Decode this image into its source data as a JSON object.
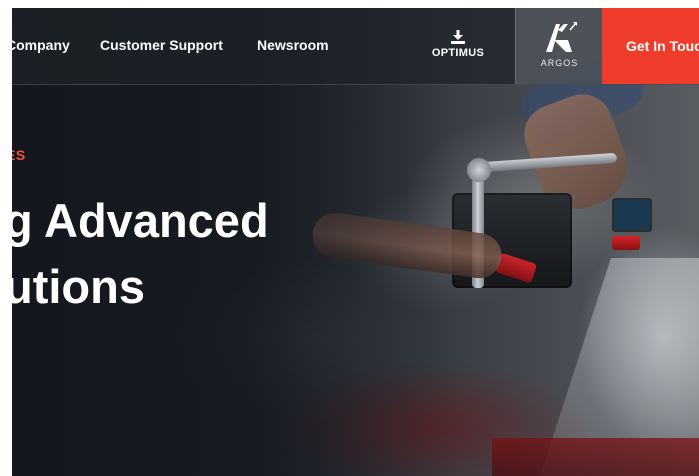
{
  "header": {
    "nav": [
      {
        "label": "Company"
      },
      {
        "label": "Customer Support"
      },
      {
        "label": "Newsroom"
      }
    ],
    "optimus": {
      "label": "OPTIMUS",
      "icon": "download-icon"
    },
    "argos": {
      "label": "ARGOS",
      "icon": "argos-logo-icon"
    },
    "cta": {
      "label": "Get In Touch"
    }
  },
  "hero": {
    "eyebrow": "ES",
    "headline_line1": "g Advanced",
    "headline_line2": "utions"
  },
  "colors": {
    "accent": "#f03d2b",
    "eyebrow": "#f0523f",
    "header_bg": "#1e2228"
  }
}
